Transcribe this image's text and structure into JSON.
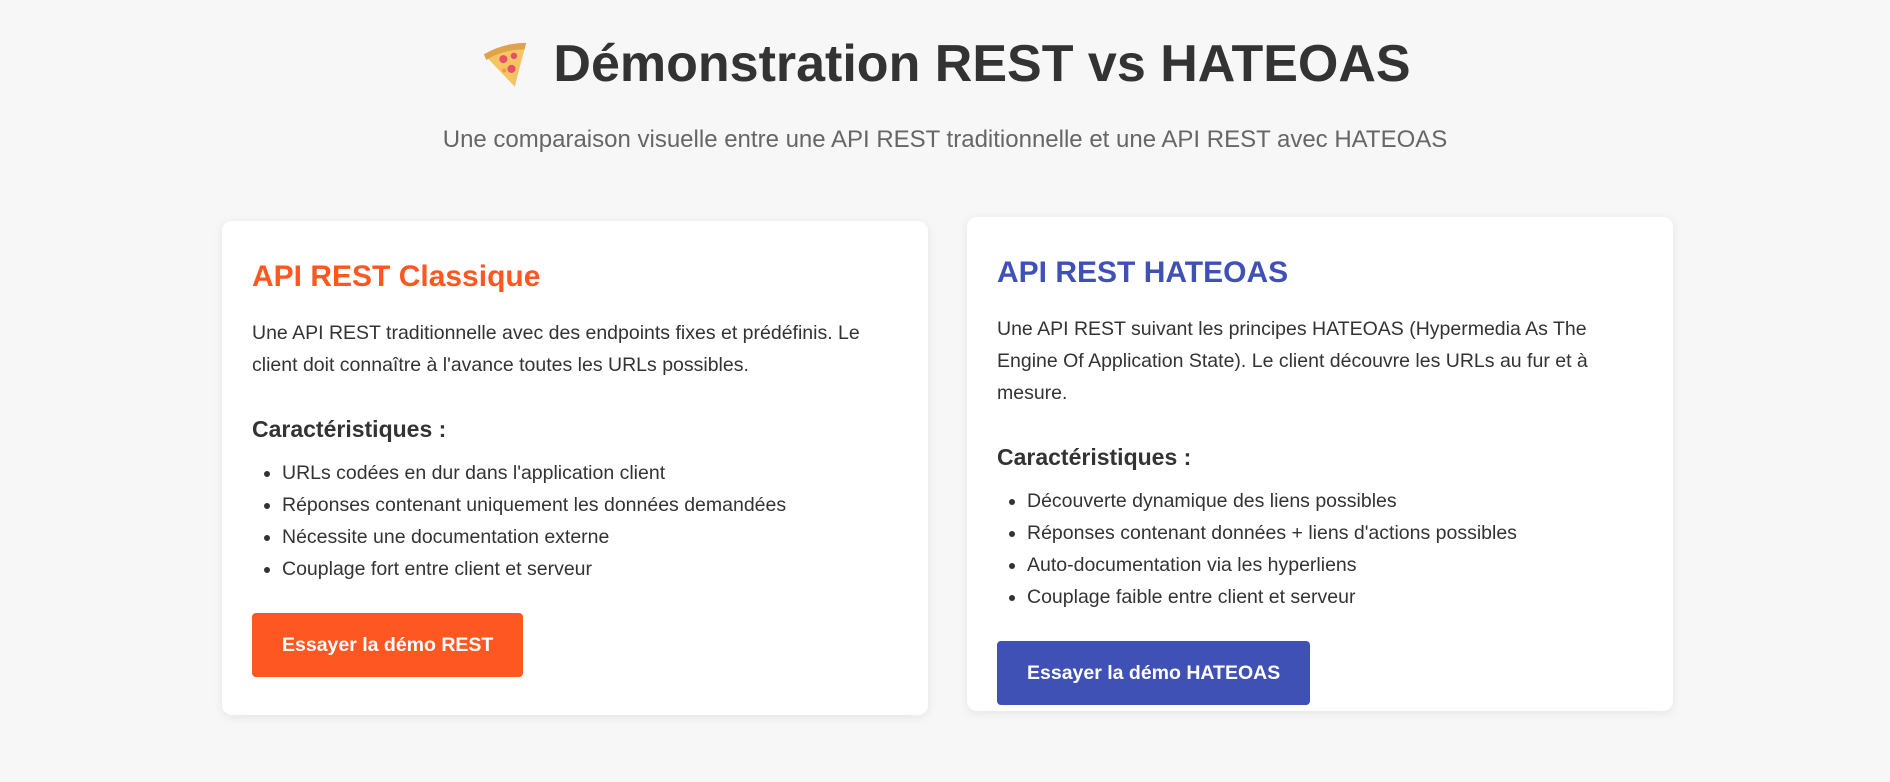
{
  "header": {
    "icon": "pizza-icon",
    "title": "Démonstration REST vs HATEOAS",
    "subtitle": "Une comparaison visuelle entre une API REST traditionnelle et une API REST avec HATEOAS"
  },
  "cards": [
    {
      "title": "API REST Classique",
      "description": "Une API REST traditionnelle avec des endpoints fixes et prédéfinis. Le client doit connaître à l'avance toutes les URLs possibles.",
      "features_heading": "Caractéristiques :",
      "features": [
        "URLs codées en dur dans l'application client",
        "Réponses contenant uniquement les données demandées",
        "Nécessite une documentation externe",
        "Couplage fort entre client et serveur"
      ],
      "button_label": "Essayer la démo REST",
      "accent_color": "#ff5722"
    },
    {
      "title": "API REST HATEOAS",
      "description": "Une API REST suivant les principes HATEOAS (Hypermedia As The Engine Of Application State). Le client découvre les URLs au fur et à mesure.",
      "features_heading": "Caractéristiques :",
      "features": [
        "Découverte dynamique des liens possibles",
        "Réponses contenant données + liens d'actions possibles",
        "Auto-documentation via les hyperliens",
        "Couplage faible entre client et serveur"
      ],
      "button_label": "Essayer la démo HATEOAS",
      "accent_color": "#3f51b5"
    }
  ]
}
